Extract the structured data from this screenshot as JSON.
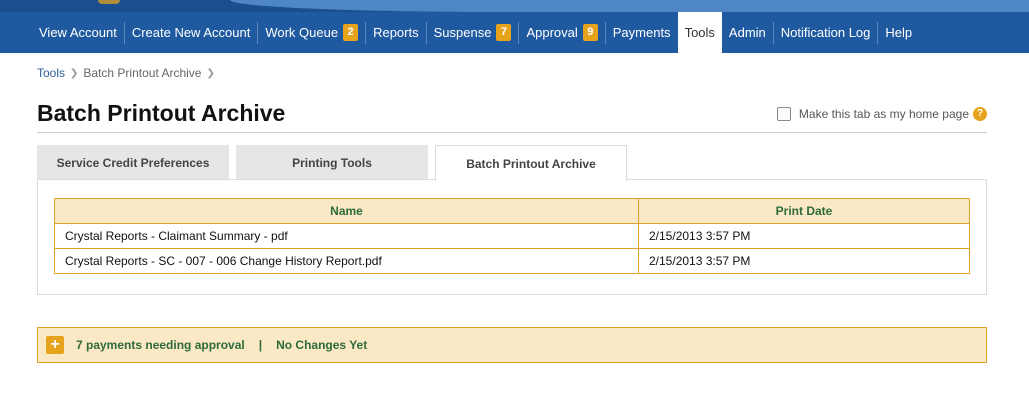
{
  "nav": {
    "items": [
      {
        "label": "View Account"
      },
      {
        "label": "Create New Account"
      },
      {
        "label": "Work Queue",
        "badge": "2"
      },
      {
        "label": "Reports"
      },
      {
        "label": "Suspense",
        "badge": "7"
      },
      {
        "label": "Approval",
        "badge": "9"
      },
      {
        "label": "Payments"
      },
      {
        "label": "Tools",
        "active": true
      },
      {
        "label": "Admin"
      },
      {
        "label": "Notification Log"
      },
      {
        "label": "Help"
      }
    ]
  },
  "breadcrumb": {
    "items": [
      "Tools",
      "Batch Printout Archive"
    ]
  },
  "page": {
    "title": "Batch Printout Archive",
    "home_pref_label": "Make this tab as my home page",
    "help_icon": "?"
  },
  "tabs": [
    {
      "label": "Service Credit Preferences"
    },
    {
      "label": "Printing Tools"
    },
    {
      "label": "Batch Printout Archive",
      "active": true
    }
  ],
  "table": {
    "headers": [
      "Name",
      "Print Date"
    ],
    "rows": [
      [
        "Crystal Reports - Claimant Summary - pdf",
        "2/15/2013 3:57 PM"
      ],
      [
        "Crystal Reports - SC - 007 - 006 Change History Report.pdf",
        "2/15/2013 3:57 PM"
      ]
    ]
  },
  "approval": {
    "expand_icon": "+",
    "link_label": "7 payments needing approval",
    "separator": "|",
    "status": "No Changes Yet"
  },
  "colors": {
    "nav_bg": "#1f5aa0",
    "badge": "#e8a31d",
    "table_header_bg": "#fbe8c5",
    "table_border": "#e0a12a",
    "green_text": "#2d6b3a"
  }
}
